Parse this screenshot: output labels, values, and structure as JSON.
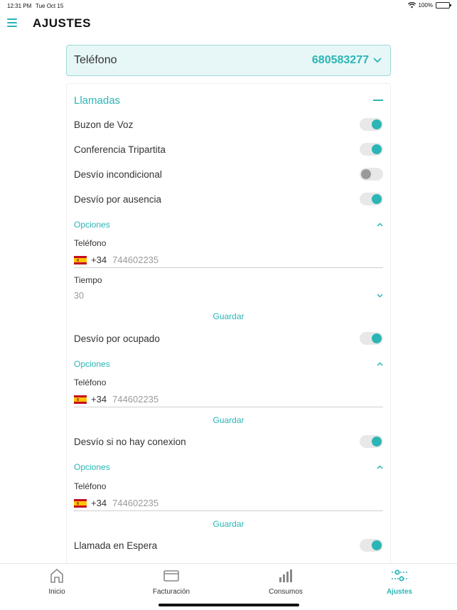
{
  "status_bar": {
    "time": "12:31 PM",
    "date": "Tue Oct 15",
    "battery": "100%"
  },
  "header": {
    "title": "AJUSTES",
    "menu_icon": "hamburger-icon"
  },
  "phone_selector": {
    "label": "Teléfono",
    "value": "680583277"
  },
  "section": {
    "title": "Llamadas",
    "items": [
      {
        "label": "Buzon de Voz",
        "on": true
      },
      {
        "label": "Conferencia Tripartita",
        "on": true
      },
      {
        "label": "Desvío incondicional",
        "on": false
      },
      {
        "label": "Desvío por ausencia",
        "on": true
      },
      {
        "label": "Desvío por ocupado",
        "on": true
      },
      {
        "label": "Desvío si no hay conexion",
        "on": true
      },
      {
        "label": "Llamada en Espera",
        "on": true
      }
    ],
    "options_label": "Opciones",
    "phone_field_label": "Teléfono",
    "country_prefix": "+34",
    "phone_placeholder": "744602235",
    "time_label": "Tiempo",
    "time_value": "30",
    "save_label": "Guardar"
  },
  "tabs": [
    {
      "label": "Inicio",
      "icon": "home-icon",
      "active": false
    },
    {
      "label": "Facturación",
      "icon": "card-icon",
      "active": false
    },
    {
      "label": "Consumos",
      "icon": "bar-chart-icon",
      "active": false
    },
    {
      "label": "Ajustes",
      "icon": "sliders-icon",
      "active": true
    }
  ],
  "colors": {
    "accent": "#2bb5b5",
    "selector_bg": "#e7f7f7",
    "toggle_off": "#9a9a9a",
    "flag_red": "#c60b1e",
    "flag_yellow": "#ffc400"
  }
}
